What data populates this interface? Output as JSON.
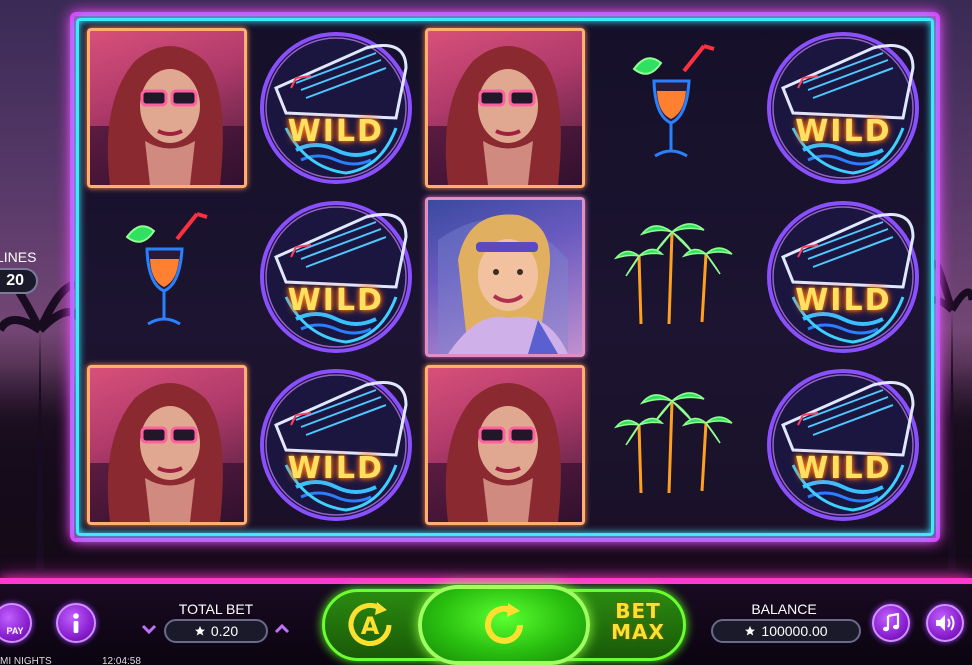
{
  "reels": [
    [
      "girl-redhead",
      "wild",
      "girl-redhead",
      "cocktail",
      "wild"
    ],
    [
      "cocktail",
      "wild",
      "girl-blonde",
      "palms",
      "wild"
    ],
    [
      "girl-redhead",
      "wild",
      "girl-redhead",
      "palms",
      "wild"
    ]
  ],
  "wild_label": "WILD",
  "lines": {
    "label": "LINES",
    "value": "20"
  },
  "total_bet": {
    "label": "TOTAL BET",
    "value": "0.20"
  },
  "balance": {
    "label": "BALANCE",
    "value": "100000.00"
  },
  "bet_max": {
    "line1": "BET",
    "line2": "MAX"
  },
  "paytable_label": "PAY",
  "footer": {
    "game_name": "MI NIGHTS",
    "clock": "12:04:58"
  },
  "icons": {
    "auto_spin": "auto-spin-icon",
    "spin": "spin-arrow-icon",
    "info": "info-icon",
    "music": "music-note-icon",
    "sound": "speaker-icon",
    "star": "star-icon"
  },
  "colors": {
    "frame_outer": "#e040ff",
    "frame_inner": "#3ee8ff",
    "spin_green": "#2ac010",
    "bet_max_yellow": "#ffe030",
    "button_purple": "#8a20d0"
  }
}
